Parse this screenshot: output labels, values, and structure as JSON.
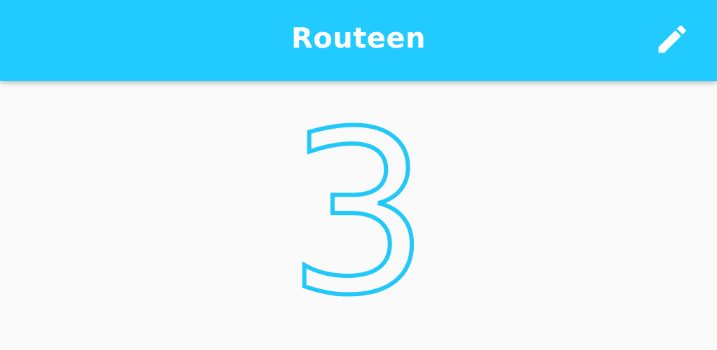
{
  "app": {
    "title": "Routeen",
    "accent_color": "#22cbff",
    "background_color": "#fafafa"
  },
  "toolbar": {
    "edit_icon": "pencil-icon"
  },
  "main": {
    "count": "3",
    "count_color": "#22c8f8"
  }
}
